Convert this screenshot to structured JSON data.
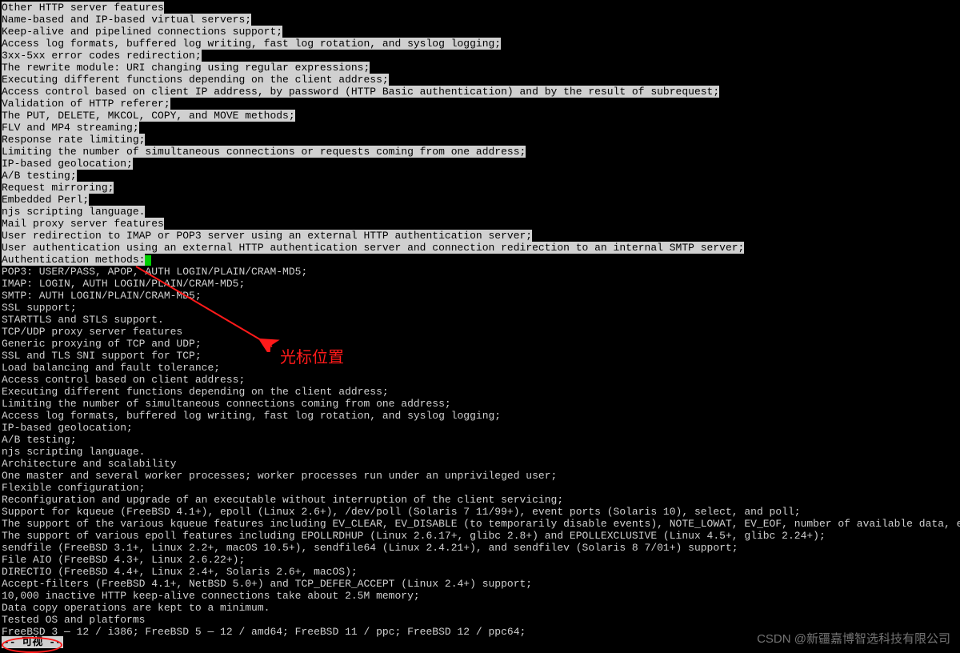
{
  "lines": [
    {
      "t": "Other HTTP server features",
      "inv": true
    },
    {
      "t": "Name-based and IP-based virtual servers;",
      "inv": true
    },
    {
      "t": "Keep-alive and pipelined connections support;",
      "inv": true
    },
    {
      "t": "Access log formats, buffered log writing, fast log rotation, and syslog logging;",
      "inv": true
    },
    {
      "t": "3xx-5xx error codes redirection;",
      "inv": true
    },
    {
      "t": "The rewrite module: URI changing using regular expressions;",
      "inv": true
    },
    {
      "t": "Executing different functions depending on the client address;",
      "inv": true
    },
    {
      "t": "Access control based on client IP address, by password (HTTP Basic authentication) and by the result of subrequest;",
      "inv": true
    },
    {
      "t": "Validation of HTTP referer;",
      "inv": true
    },
    {
      "t": "The PUT, DELETE, MKCOL, COPY, and MOVE methods;",
      "inv": true
    },
    {
      "t": "FLV and MP4 streaming;",
      "inv": true
    },
    {
      "t": "Response rate limiting;",
      "inv": true
    },
    {
      "t": "Limiting the number of simultaneous connections or requests coming from one address;",
      "inv": true
    },
    {
      "t": "IP-based geolocation;",
      "inv": true
    },
    {
      "t": "A/B testing;",
      "inv": true
    },
    {
      "t": "Request mirroring;",
      "inv": true
    },
    {
      "t": "Embedded Perl;",
      "inv": true
    },
    {
      "t": "njs scripting language.",
      "inv": true
    },
    {
      "t": "Mail proxy server features",
      "inv": true
    },
    {
      "t": "User redirection to IMAP or POP3 server using an external HTTP authentication server;",
      "inv": true
    },
    {
      "t": "User authentication using an external HTTP authentication server and connection redirection to an internal SMTP server;",
      "inv": true
    },
    {
      "t": "Authentication methods:",
      "inv": true,
      "cursor": true
    },
    {
      "t": "POP3: USER/PASS, APOP, AUTH LOGIN/PLAIN/CRAM-MD5;",
      "inv": false
    },
    {
      "t": "IMAP: LOGIN, AUTH LOGIN/PLAIN/CRAM-MD5;",
      "inv": false
    },
    {
      "t": "SMTP: AUTH LOGIN/PLAIN/CRAM-MD5;",
      "inv": false
    },
    {
      "t": "SSL support;",
      "inv": false
    },
    {
      "t": "STARTTLS and STLS support.",
      "inv": false
    },
    {
      "t": "TCP/UDP proxy server features",
      "inv": false
    },
    {
      "t": "Generic proxying of TCP and UDP;",
      "inv": false
    },
    {
      "t": "SSL and TLS SNI support for TCP;",
      "inv": false
    },
    {
      "t": "Load balancing and fault tolerance;",
      "inv": false
    },
    {
      "t": "Access control based on client address;",
      "inv": false
    },
    {
      "t": "Executing different functions depending on the client address;",
      "inv": false
    },
    {
      "t": "Limiting the number of simultaneous connections coming from one address;",
      "inv": false
    },
    {
      "t": "Access log formats, buffered log writing, fast log rotation, and syslog logging;",
      "inv": false
    },
    {
      "t": "IP-based geolocation;",
      "inv": false
    },
    {
      "t": "A/B testing;",
      "inv": false
    },
    {
      "t": "njs scripting language.",
      "inv": false
    },
    {
      "t": "Architecture and scalability",
      "inv": false
    },
    {
      "t": "One master and several worker processes; worker processes run under an unprivileged user;",
      "inv": false
    },
    {
      "t": "Flexible configuration;",
      "inv": false
    },
    {
      "t": "Reconfiguration and upgrade of an executable without interruption of the client servicing;",
      "inv": false
    },
    {
      "t": "Support for kqueue (FreeBSD 4.1+), epoll (Linux 2.6+), /dev/poll (Solaris 7 11/99+), event ports (Solaris 10), select, and poll;",
      "inv": false
    },
    {
      "t": "The support of the various kqueue features including EV_CLEAR, EV_DISABLE (to temporarily disable events), NOTE_LOWAT, EV_EOF, number of available data, error codes;",
      "inv": false
    },
    {
      "t": "The support of various epoll features including EPOLLRDHUP (Linux 2.6.17+, glibc 2.8+) and EPOLLEXCLUSIVE (Linux 4.5+, glibc 2.24+);",
      "inv": false
    },
    {
      "t": "sendfile (FreeBSD 3.1+, Linux 2.2+, macOS 10.5+), sendfile64 (Linux 2.4.21+), and sendfilev (Solaris 8 7/01+) support;",
      "inv": false
    },
    {
      "t": "File AIO (FreeBSD 4.3+, Linux 2.6.22+);",
      "inv": false
    },
    {
      "t": "DIRECTIO (FreeBSD 4.4+, Linux 2.4+, Solaris 2.6+, macOS);",
      "inv": false
    },
    {
      "t": "Accept-filters (FreeBSD 4.1+, NetBSD 5.0+) and TCP_DEFER_ACCEPT (Linux 2.4+) support;",
      "inv": false
    },
    {
      "t": "10,000 inactive HTTP keep-alive connections take about 2.5M memory;",
      "inv": false
    },
    {
      "t": "Data copy operations are kept to a minimum.",
      "inv": false
    },
    {
      "t": "Tested OS and platforms",
      "inv": false
    },
    {
      "t": "FreeBSD 3 — 12 / i386; FreeBSD 5 — 12 / amd64; FreeBSD 11 / ppc; FreeBSD 12 / ppc64;",
      "inv": false
    }
  ],
  "status": "-- 可视 --",
  "annotation_label": "光标位置",
  "watermark": "CSDN @新疆嘉博智选科技有限公司"
}
